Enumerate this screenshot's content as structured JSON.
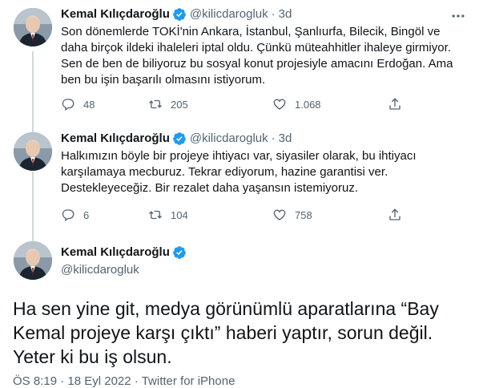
{
  "tweets": [
    {
      "name": "Kemal Kılıçdaroğlu",
      "handle": "@kilicdarogluk",
      "dot": "·",
      "time": "3d",
      "text": "Son dönemlerde TOKİ'nin Ankara, İstanbul, Şanlıurfa, Bilecik, Bingöl ve\ndaha birçok ildeki ihaleleri iptal oldu. Çünkü müteahhitler ihaleye girmiyor.\nSen de ben de biliyoruz bu sosyal konut projesiyle amacını Erdoğan. Ama\nben bu işin başarılı olmasını istiyorum.",
      "replies": "48",
      "retweets": "205",
      "likes": "1.068"
    },
    {
      "name": "Kemal Kılıçdaroğlu",
      "handle": "@kilicdarogluk",
      "dot": "·",
      "time": "3d",
      "text": "Halkımızın böyle bir projeye ihtiyacı var, siyasiler olarak, bu ihtiyacı\nkarşılamaya mecburuz. Tekrar ediyorum, hazine garantisi ver.\nDestekleyeceğiz. Bir rezalet daha yaşansın istemiyoruz.",
      "replies": "6",
      "retweets": "104",
      "likes": "758"
    }
  ],
  "main_tweet": {
    "name": "Kemal Kılıçdaroğlu",
    "handle": "@kilicdarogluk",
    "text": "Ha sen yine git, medya görünümlü aparatlarına “Bay\nKemal projeye karşı çıktı” haberi yaptır, sorun değil.\nYeter ki bu iş olsun.",
    "time": "ÖS 8:19",
    "dot": "·",
    "date": "18 Eyl 2022",
    "source": "Twitter for iPhone"
  },
  "colors": {
    "verified": "#1d9bf0",
    "secondary_text": "#536471",
    "thread_line": "#cfd9de"
  },
  "icons": [
    "more-icon",
    "verified-badge-icon",
    "reply-icon",
    "retweet-icon",
    "like-icon",
    "share-icon"
  ]
}
